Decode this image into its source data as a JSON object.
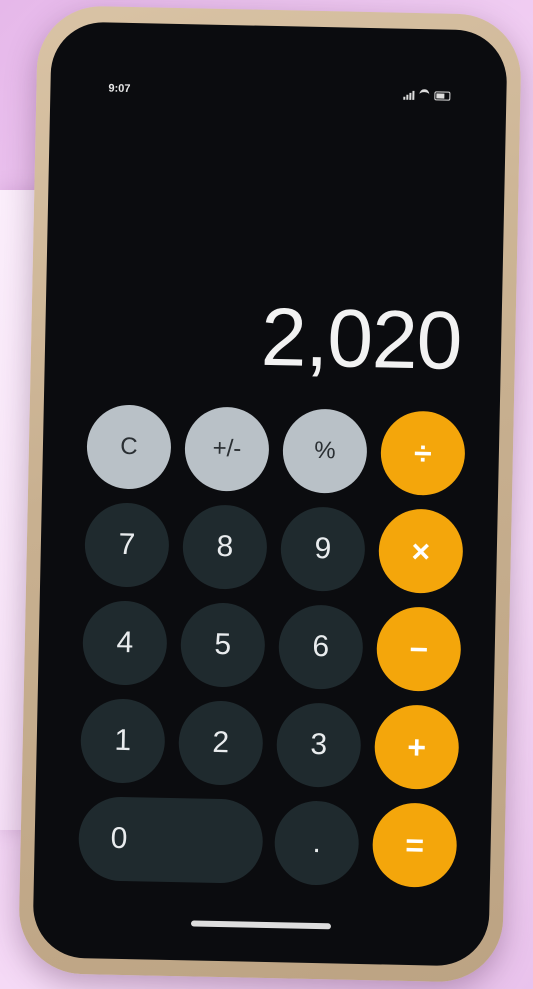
{
  "status_bar": {
    "time": "9:07"
  },
  "display": {
    "value": "2,020"
  },
  "keypad": {
    "row1": [
      "C",
      "+/-",
      "%",
      "÷"
    ],
    "row2": [
      "7",
      "8",
      "9",
      "×"
    ],
    "row3": [
      "4",
      "5",
      "6",
      "−"
    ],
    "row4": [
      "1",
      "2",
      "3",
      "+"
    ],
    "row5": [
      "0",
      ".",
      "="
    ]
  },
  "colors": {
    "operator": "#f4a60b",
    "function": "#b9c1c7",
    "number": "#1f2a2e",
    "screen": "#0b0c0f",
    "background": "#e6b8ea"
  }
}
